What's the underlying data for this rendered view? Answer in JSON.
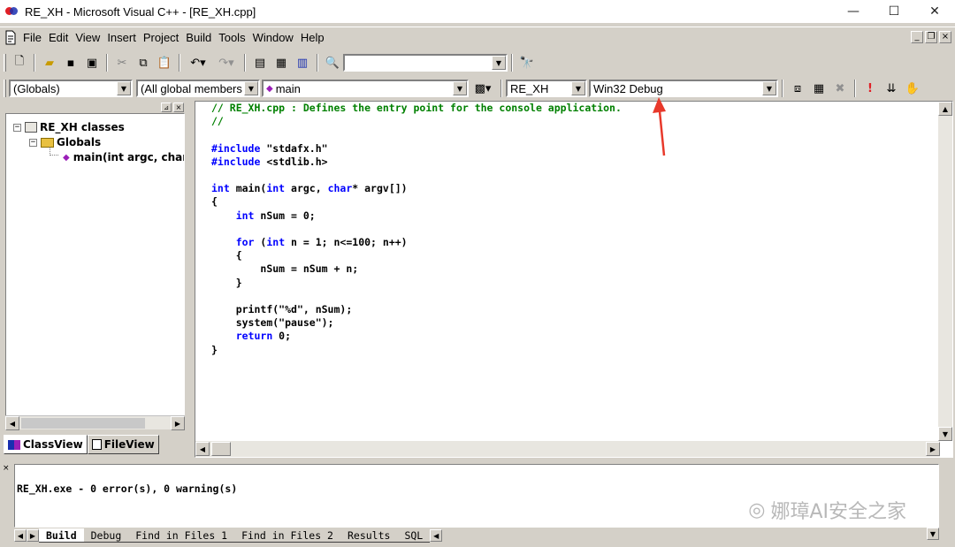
{
  "window": {
    "title": "RE_XH - Microsoft Visual C++ - [RE_XH.cpp]",
    "minimize": "—",
    "maximize": "☐",
    "close": "✕"
  },
  "menu": {
    "items": [
      "File",
      "Edit",
      "View",
      "Insert",
      "Project",
      "Build",
      "Tools",
      "Window",
      "Help"
    ]
  },
  "toolbar2": {
    "scope_combo": "(Globals)",
    "members_combo": "(All global members",
    "function_combo": "main",
    "project_combo": "RE_XH",
    "config_combo": "Win32 Debug"
  },
  "classview": {
    "root": "RE_XH classes",
    "globals": "Globals",
    "func": "main(int argc, char",
    "tab_classview": "ClassView",
    "tab_fileview": "FileView"
  },
  "code": {
    "line1": "// RE_XH.cpp : Defines the entry point for the console application.",
    "line2": "//",
    "inc1_kw": "#include",
    "inc1_arg": " \"stdafx.h\"",
    "inc2_kw": "#include",
    "inc2_arg": " <stdlib.h>",
    "main_kw1": "int",
    "main_mid": " main(",
    "main_kw2": "int",
    "main_mid2": " argc, ",
    "main_kw3": "char",
    "main_end": "* argv[])",
    "open_brace": "{",
    "decl_kw": "int",
    "decl_rest": " nSum = 0;",
    "for_kw": "for",
    "for_mid": " (",
    "for_kw2": "int",
    "for_rest": " n = 1; n<=100; n++)",
    "for_open": "{",
    "body": "nSum = nSum + n;",
    "for_close": "}",
    "printf": "printf(\"%d\", nSum);",
    "system": "system(\"pause\");",
    "ret_kw": "return",
    "ret_rest": " 0;",
    "close_brace": "}"
  },
  "output": {
    "message": "RE_XH.exe - 0 error(s), 0 warning(s)",
    "tabs": [
      "Build",
      "Debug",
      "Find in Files 1",
      "Find in Files 2",
      "Results",
      "SQL"
    ],
    "watermark": "娜璋AI安全之家"
  },
  "colors": {
    "comment": "#008000",
    "keyword": "#0000ff",
    "face": "#d4d0c8",
    "arrow": "#e8392b"
  }
}
